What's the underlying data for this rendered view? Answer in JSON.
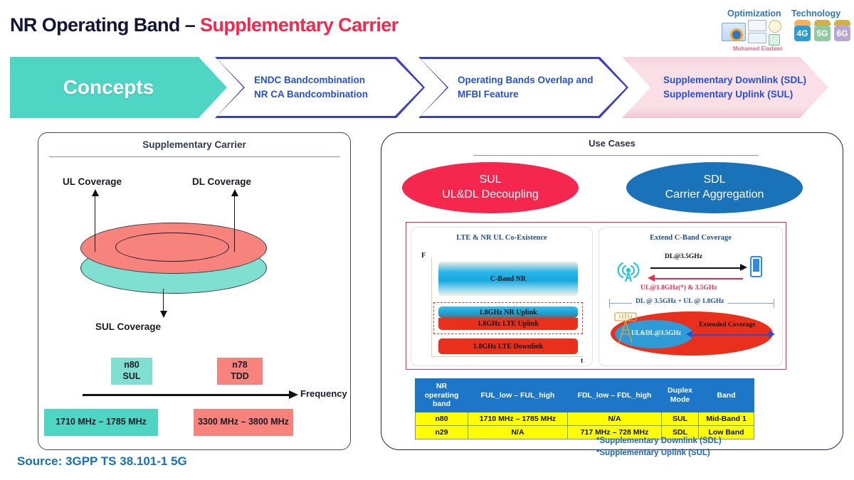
{
  "title": {
    "main": "NR Operating Band – ",
    "accent": "Supplementary Carrier"
  },
  "brand": {
    "optimization": "Optimization",
    "technology": "Technology",
    "author": "Mohamed Eladawi",
    "badges": [
      "4G",
      "5G",
      "6G"
    ]
  },
  "process": {
    "steps": [
      {
        "label": "Concepts"
      },
      {
        "line1": "ENDC Bandcombination",
        "line2": "NR CA Bandcombination"
      },
      {
        "line1": "Operating Bands Overlap and",
        "line2": "MFBI Feature"
      },
      {
        "line1": "Supplementary Downlink (SDL)",
        "line2": "Supplementary Uplink (SUL)"
      }
    ]
  },
  "left_panel": {
    "title": "Supplementary Carrier",
    "ul_coverage": "UL Coverage",
    "dl_coverage": "DL Coverage",
    "sul_coverage": "SUL Coverage",
    "chip_n80": "n80\nSUL",
    "chip_n80_line1": "n80",
    "chip_n80_line2": "SUL",
    "chip_n78_line1": "n78",
    "chip_n78_line2": "TDD",
    "range_low": "1710 MHz – 1785 MHz",
    "range_high": "3300 MHz – 3800 MHz",
    "frequency_axis": "Frequency"
  },
  "source": "Source: 3GPP TS 38.101-1 5G",
  "right_panel": {
    "title": "Use Cases",
    "use_cases": [
      {
        "line1": "SUL",
        "line2": "UL&DL Decoupling",
        "color": "#F5274E"
      },
      {
        "line1": "SDL",
        "line2": "Carrier Aggregation",
        "color": "#1A72B8"
      }
    ],
    "card_left": {
      "title": "LTE & NR UL Co-Existence",
      "axis_y": "F",
      "axis_x": "t",
      "bands": [
        "C-Band NR",
        "1.8GHz NR Uplink",
        "1.8GHz LTE Uplink",
        "1.8GHz LTE Downlink"
      ]
    },
    "card_right": {
      "title": "Extend C-Band Coverage",
      "dl_label": "DL@3.5GHz",
      "ul_label": "UL@1.8GHz(*) & 3.5GHz",
      "span_label": "DL @ 3.5GHz + UL @ 1.8GHz",
      "inner_coverage": "UL&DL@3.5GHz",
      "extended_coverage": "Extended Coverage"
    }
  },
  "table": {
    "headers": [
      "NR operating band",
      "FUL_low – FUL_high",
      "FDL_low – FDL_high",
      "Duplex Mode",
      "Band"
    ],
    "header_lines": {
      "h1a": "NR operating",
      "h1b": "band",
      "h2": "FUL_low – FUL_high",
      "h3": "FDL_low – FDL_high",
      "h4a": "Duplex",
      "h4b": "Mode",
      "h5": "Band"
    },
    "rows": [
      {
        "band": "n80",
        "ful": "1710 MHz – 1785 MHz",
        "fdl": "N/A",
        "duplex": "SUL",
        "group": "Mid-Band 1"
      },
      {
        "band": "n29",
        "ful": "N/A",
        "fdl": "717 MHz – 728 MHz",
        "duplex": "SDL",
        "group": "Low Band"
      }
    ]
  },
  "footnotes": {
    "line1": "*Supplementary Downlink (SDL)",
    "line2": "*Supplementary Uplink (SUL)"
  }
}
